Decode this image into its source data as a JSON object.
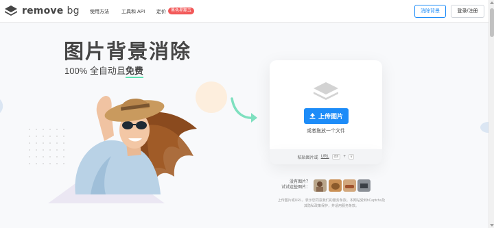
{
  "header": {
    "logo_text_remove": "remove",
    "logo_text_bg": "bg",
    "nav": {
      "how_to": "使用方法",
      "tools_api": "工具和 API",
      "pricing": "定价",
      "pricing_badge": "黑色星期五"
    },
    "remove_bg_button": "消除背景",
    "login_button": "登录/注册"
  },
  "hero": {
    "title": "图片背景消除",
    "subtitle_prefix": "100% 全自动且",
    "subtitle_emphasis": "免费"
  },
  "upload": {
    "button_label": "上传图片",
    "drop_text": "或者拖放一个文件",
    "paste_prefix": "粘贴图片或",
    "paste_url": "URL",
    "kbd_ctrl": "ctrl",
    "kbd_plus": "+",
    "kbd_v": "v"
  },
  "samples": {
    "line1": "没有图片？",
    "line2": "试试这些图片："
  },
  "terms": {
    "line1": "上传图片或URL，表示您同意我们的服务条款。本网站受到hCaptcha及",
    "line2": "其隐私政策保护，并适用服务条款。"
  },
  "icons": {
    "logo": "layers-logo-icon",
    "upload": "upload-arrow-icon",
    "placeholder": "layers-placeholder-icon",
    "arrow": "curved-arrow-icon"
  },
  "colors": {
    "accent": "#1d8cf8",
    "badge": "#f25757",
    "highlight": "#5fe3b3"
  }
}
